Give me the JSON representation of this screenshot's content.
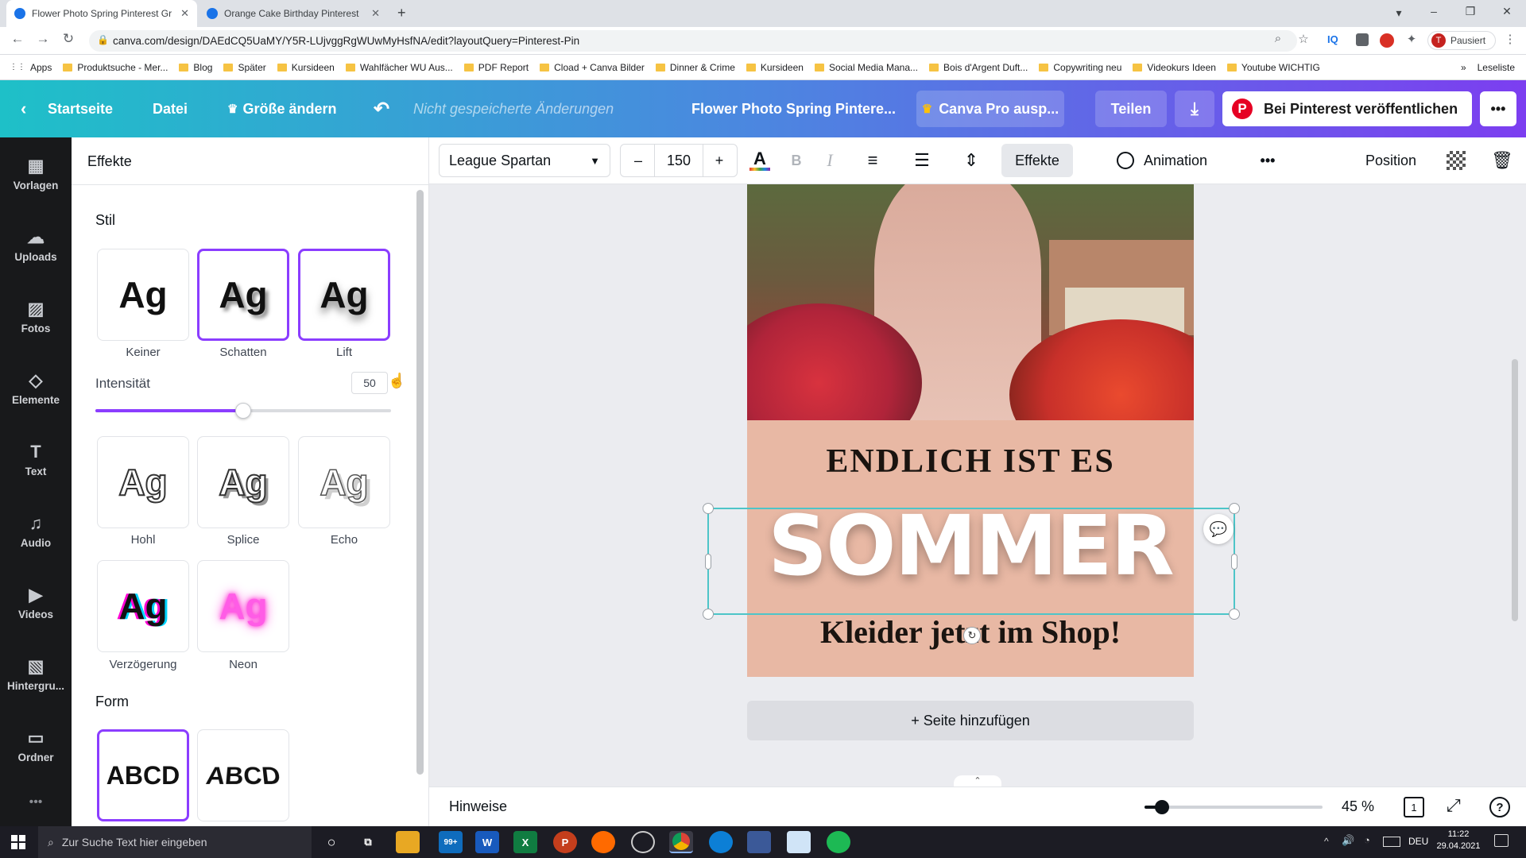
{
  "browser": {
    "tabs": [
      {
        "title": "Flower Photo Spring Pinterest Gr",
        "close": "✕"
      },
      {
        "title": "Orange Cake Birthday Pinterest",
        "close": "✕"
      }
    ],
    "new_tab": "+",
    "url": "canva.com/design/DAEdCQ5UaMY/Y5R-LUjvggRgWUwMyHsfNA/edit?layoutQuery=Pinterest-Pin",
    "profile_label": "Pausiert",
    "profile_initial": "T",
    "bookmarks": [
      "Apps",
      "Produktsuche - Mer...",
      "Blog",
      "Später",
      "Kursideen",
      "Wahlfächer WU Aus...",
      "PDF Report",
      "Cload + Canva Bilder",
      "Dinner & Crime",
      "Kursideen",
      "Social Media Mana...",
      "Bois d'Argent Duft...",
      "Copywriting neu",
      "Videokurs Ideen",
      "Youtube WICHTIG"
    ],
    "bookmarks_more": "»",
    "reading_list": "Leseliste"
  },
  "header": {
    "home": "Startseite",
    "file": "Datei",
    "resize": "Größe ändern",
    "unsaved": "Nicht gespeicherte Änderungen",
    "doc_title": "Flower Photo Spring Pintere...",
    "pro": "Canva Pro ausp...",
    "share": "Teilen",
    "publish": "Bei Pinterest veröffentlichen",
    "more": "•••"
  },
  "rail": [
    {
      "label": "Vorlagen",
      "icon": "▦"
    },
    {
      "label": "Uploads",
      "icon": "☁"
    },
    {
      "label": "Fotos",
      "icon": "▨"
    },
    {
      "label": "Elemente",
      "icon": "◇"
    },
    {
      "label": "Text",
      "icon": "T"
    },
    {
      "label": "Audio",
      "icon": "♫"
    },
    {
      "label": "Videos",
      "icon": "▶"
    },
    {
      "label": "Hintergru...",
      "icon": "▧"
    },
    {
      "label": "Ordner",
      "icon": "▭"
    }
  ],
  "rail_more": "•••",
  "panel": {
    "title": "Effekte",
    "style_heading": "Stil",
    "styles_row1": [
      {
        "label": "Keiner",
        "sample": "Ag"
      },
      {
        "label": "Schatten",
        "sample": "Ag"
      },
      {
        "label": "Lift",
        "sample": "Ag"
      }
    ],
    "intensity_label": "Intensität",
    "intensity_value": "50",
    "intensity_fraction": 0.5,
    "styles_row2": [
      {
        "label": "Hohl",
        "sample": "Ag"
      },
      {
        "label": "Splice",
        "sample": "Ag"
      },
      {
        "label": "Echo",
        "sample": "Ag"
      }
    ],
    "styles_row3": [
      {
        "label": "Verzögerung",
        "sample": "Ag"
      },
      {
        "label": "Neon",
        "sample": "Ag"
      }
    ],
    "shape_heading": "Form",
    "shapes": [
      "ABCD",
      "ABCD"
    ]
  },
  "toolbar": {
    "font": "League Spartan",
    "minus": "–",
    "size": "150",
    "plus": "+",
    "effects": "Effekte",
    "animation": "Animation",
    "more": "•••",
    "position": "Position"
  },
  "design": {
    "line1": "ENDLICH IST ES",
    "line2": "SOMMER",
    "line3": "Kleider jetzt im Shop!"
  },
  "canvas": {
    "add_page": "+ Seite hinzufügen"
  },
  "bottom": {
    "notes": "Hinweise",
    "zoom": "45 %",
    "zoom_fraction": 0.1,
    "page_count": "1"
  },
  "taskbar": {
    "search_placeholder": "Zur Suche Text hier eingeben",
    "badge": "99+",
    "lang": "DEU",
    "time": "11:22",
    "date": "29.04.2021"
  },
  "colors": {
    "accent": "#8b3dff",
    "selection": "#4dc5c8",
    "design_bg": "#e8b8a4"
  }
}
